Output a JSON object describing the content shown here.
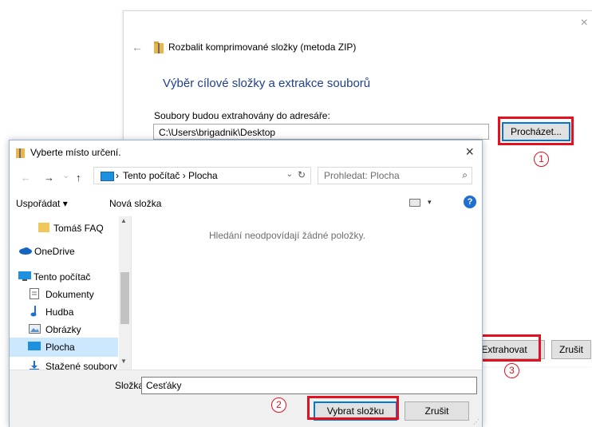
{
  "wizard": {
    "close_glyph": "×",
    "back_glyph": "←",
    "title": "Rozbalit komprimované složky (metoda ZIP)",
    "heading": "Výběr cílové složky a extrakce souborů",
    "dest_label": "Soubory budou extrahovány do adresáře:",
    "dest_path": "C:\\Users\\brigadnik\\Desktop",
    "browse_label": "Procházet...",
    "extract_label": "Extrahovat",
    "cancel_label": "Zrušit"
  },
  "annotations": {
    "step1": "1",
    "step2": "2",
    "step3": "3",
    "color": "#e3101f"
  },
  "dialog": {
    "title": "Vyberte místo určení.",
    "close_glyph": "×",
    "nav": {
      "back": "←",
      "forward": "→",
      "recent": "⌄",
      "up": "↑"
    },
    "address": {
      "path": "Tento počítač  ›  Plocha",
      "prefix": "›",
      "dropdown": "⌄",
      "refresh": "↻"
    },
    "search": {
      "placeholder": "Prohledat: Plocha",
      "icon": "⌕"
    },
    "toolbar": {
      "organize": "Uspořádat ▾",
      "new_folder": "Nová složka",
      "view_dropdown": "▾",
      "help": "?"
    },
    "nav_items": [
      {
        "label": "Tomáš FAQ",
        "icon": "folder-icon"
      },
      {
        "label": "OneDrive",
        "icon": "cloud-icon"
      },
      {
        "label": "Tento počítač",
        "icon": "computer-icon"
      },
      {
        "label": "Dokumenty",
        "icon": "documents-icon"
      },
      {
        "label": "Hudba",
        "icon": "music-icon"
      },
      {
        "label": "Obrázky",
        "icon": "pictures-icon"
      },
      {
        "label": "Plocha",
        "icon": "desktop-icon",
        "selected": true
      },
      {
        "label": "Stažené soubory",
        "icon": "downloads-icon"
      }
    ],
    "empty_message": "Hledání neodpovídají žádné položky.",
    "folder_label": "Složka:",
    "folder_value": "Cesťáky",
    "select_label": "Vybrat složku",
    "cancel_label": "Zrušit"
  },
  "colors": {
    "accent": "#0078d7",
    "heading": "#1e3f8f",
    "selection": "#cce8ff",
    "annotation": "#e3101f"
  }
}
